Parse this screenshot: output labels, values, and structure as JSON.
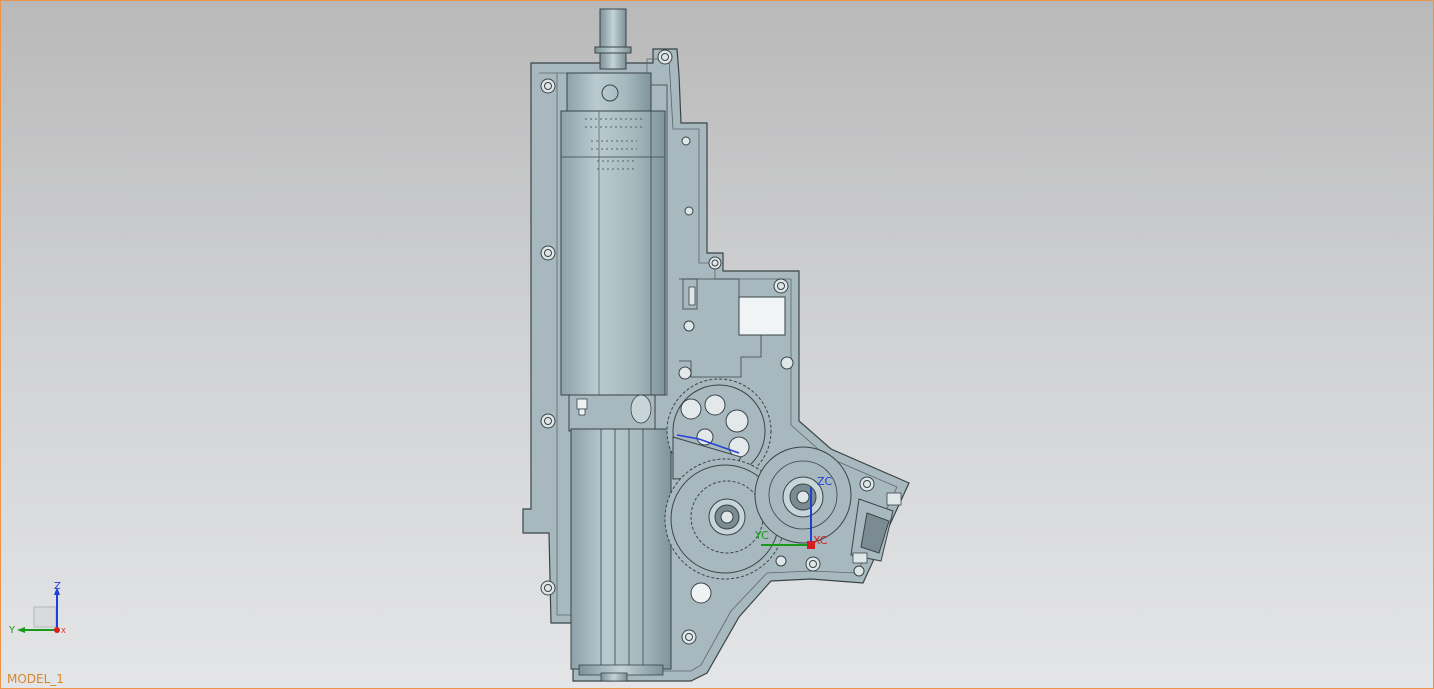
{
  "viewport": {
    "view_name": "MODEL_1",
    "background_top": "#b9b9b9",
    "background_bottom": "#e4e5e7",
    "frame_color": "#e8944a"
  },
  "triad": {
    "z_label": "Z",
    "y_label": "Y",
    "x_label": "X",
    "z_color": "#1e3fd8",
    "y_color": "#1a9a1a",
    "x_color": "#d42020"
  },
  "wcs": {
    "zc_label": "ZC",
    "yc_label": "YC",
    "xc_label": "XC"
  },
  "model": {
    "part_color": "#a3b6bb",
    "edge_color": "#3a4448",
    "cylinder_color": "#9eb2b8"
  }
}
